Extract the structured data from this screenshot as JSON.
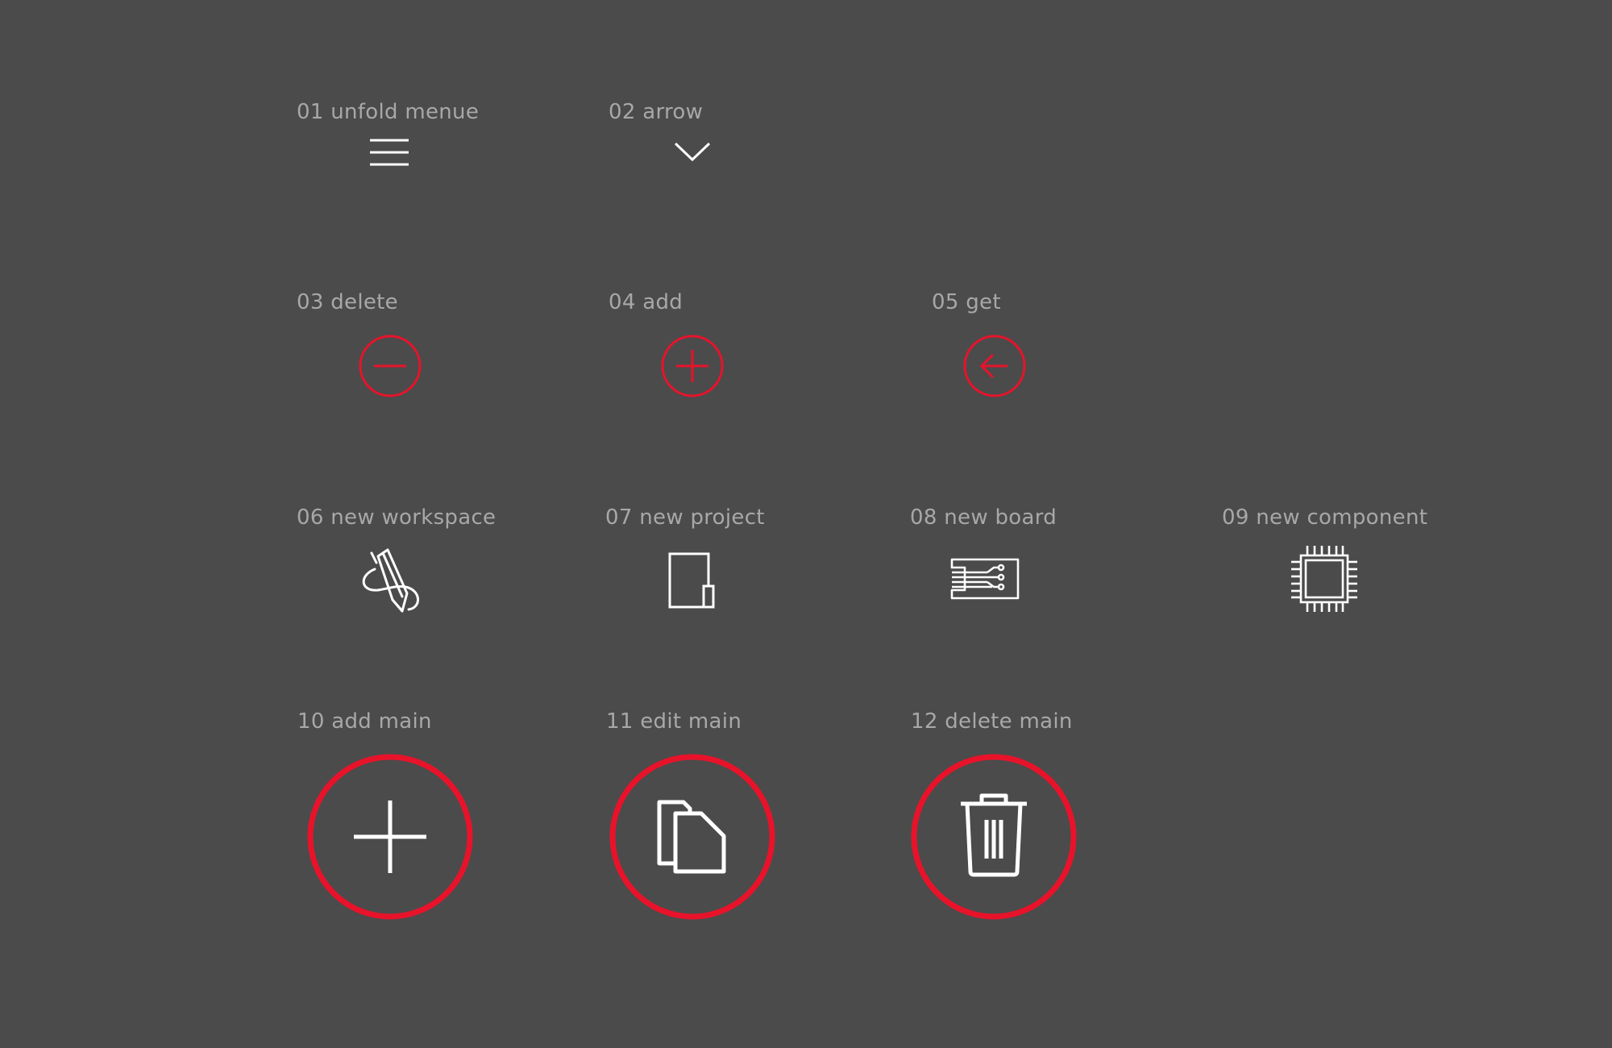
{
  "colors": {
    "background": "#4b4b4b",
    "label": "#a8a8a8",
    "icon_line": "#ffffff",
    "accent_red": "#e8132a"
  },
  "icons": [
    {
      "label": "01 unfold menue",
      "icon": "hamburger-menu-icon"
    },
    {
      "label": "02 arrow",
      "icon": "chevron-down-icon"
    },
    {
      "label": "03 delete",
      "icon": "minus-circle-icon"
    },
    {
      "label": "04 add",
      "icon": "plus-circle-icon"
    },
    {
      "label": "05 get",
      "icon": "arrow-left-circle-icon"
    },
    {
      "label": "06 new workspace",
      "icon": "pen-signature-icon"
    },
    {
      "label": "07 new project",
      "icon": "document-icon"
    },
    {
      "label": "08 new board",
      "icon": "circuit-board-icon"
    },
    {
      "label": "09 new component",
      "icon": "chip-icon"
    },
    {
      "label": "10 add main",
      "icon": "add-main-icon"
    },
    {
      "label": "11 edit main",
      "icon": "copy-documents-icon"
    },
    {
      "label": "12 delete main",
      "icon": "trash-icon"
    }
  ]
}
